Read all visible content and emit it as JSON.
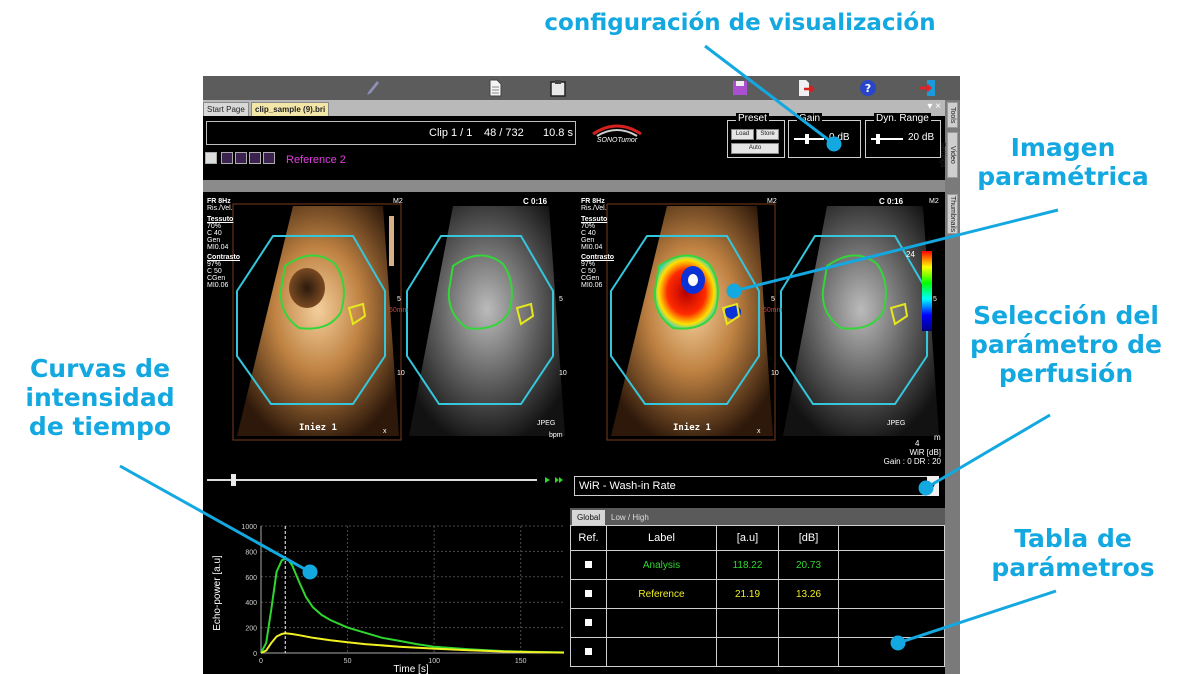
{
  "callouts": {
    "config": "configuración de visualización",
    "imagen": [
      "Imagen",
      "paramétrica"
    ],
    "seleccion": [
      "Selección del",
      "parámetro de",
      "perfusión"
    ],
    "curvas": [
      "Curvas de",
      "intensidad",
      "de tiempo"
    ],
    "tabla": [
      "Tabla de",
      "parámetros"
    ]
  },
  "colors": {
    "callout": "#13a8e0",
    "analysis": "#2fd62f",
    "reference": "#f0f023",
    "reference_label": "#e23ee0"
  },
  "toolbar": {
    "icons": [
      "brush-icon",
      "document-icon",
      "clipboard-icon",
      "save-icon",
      "export-icon",
      "help-icon",
      "exit-icon"
    ]
  },
  "tabs": {
    "start": "Start Page",
    "clip": "clip_sample (9).bri",
    "controls": "▾ ×"
  },
  "side_tabs": [
    "Tools",
    "Video Settings",
    "Thumbnails"
  ],
  "clip": {
    "label": "Clip 1 / 1",
    "frame": "48 / 732",
    "time": "10.8 s"
  },
  "logo": "SONOTumor",
  "preset": {
    "title": "Preset",
    "load": "Load",
    "store": "Store",
    "auto": "Auto"
  },
  "gain": {
    "title": "Gain",
    "value": "0 dB"
  },
  "dyn_range": {
    "title": "Dyn. Range",
    "value": "20 dB"
  },
  "reference_label": "Reference 2",
  "panes": {
    "header_left": [
      "FR 8Hz",
      "Ris./Vel."
    ],
    "header_right": "C 0:16",
    "corner": "M2",
    "labels": [
      "Tessuto",
      "70%",
      "C 40",
      "Gen",
      "MI0.04",
      "Contrasto",
      "97%",
      "C 50",
      "CGen",
      "MI0.06"
    ],
    "depth_5": "5",
    "depth_10": "10",
    "depth_mm": "50mm",
    "bottom_left": "Iniez 1",
    "jpeg": "JPEG",
    "bpm": "bpm",
    "x": "x"
  },
  "colorbar": {
    "top": "24",
    "bottom": "4",
    "unit": "WiR [dB]",
    "gain_dr": "Gain : 0  DR : 20",
    "m": "m"
  },
  "dropdown": {
    "selected": "WiR - Wash-in Rate"
  },
  "chart_data": {
    "type": "line",
    "xlabel": "Time [s]",
    "ylabel": "Echo-power [a.u]",
    "xlim": [
      0,
      175
    ],
    "ylim": [
      0,
      1000
    ],
    "xticks": [
      0,
      50,
      100,
      150
    ],
    "yticks": [
      0,
      200,
      400,
      600,
      800,
      1000
    ],
    "grid": true,
    "series": [
      {
        "x": [
          0,
          3,
          6,
          9,
          12,
          14,
          16,
          18,
          22,
          26,
          30,
          35,
          40,
          50,
          60,
          70,
          80,
          90,
          100,
          120,
          140,
          160,
          175
        ],
        "values": [
          0,
          80,
          350,
          640,
          730,
          740,
          730,
          690,
          560,
          440,
          360,
          300,
          260,
          200,
          160,
          120,
          95,
          70,
          50,
          30,
          15,
          8,
          5
        ]
      },
      {
        "x": [
          0,
          3,
          6,
          9,
          12,
          14,
          18,
          22,
          30,
          40,
          50,
          60,
          80,
          100,
          120,
          140,
          160,
          175
        ],
        "values": [
          0,
          20,
          80,
          130,
          150,
          155,
          150,
          140,
          120,
          100,
          85,
          70,
          50,
          35,
          22,
          12,
          6,
          3
        ]
      }
    ]
  },
  "ptable": {
    "tabs": [
      "Global",
      "Low / High"
    ],
    "headers": [
      "Ref.",
      "Label",
      "[a.u]",
      "[dB]",
      ""
    ],
    "rows": [
      {
        "label": "Analysis",
        "au": "118.22",
        "db": "20.73"
      },
      {
        "label": "Reference",
        "au": "21.19",
        "db": "13.26"
      },
      {
        "label": "",
        "au": "",
        "db": ""
      },
      {
        "label": "",
        "au": "",
        "db": ""
      }
    ]
  }
}
